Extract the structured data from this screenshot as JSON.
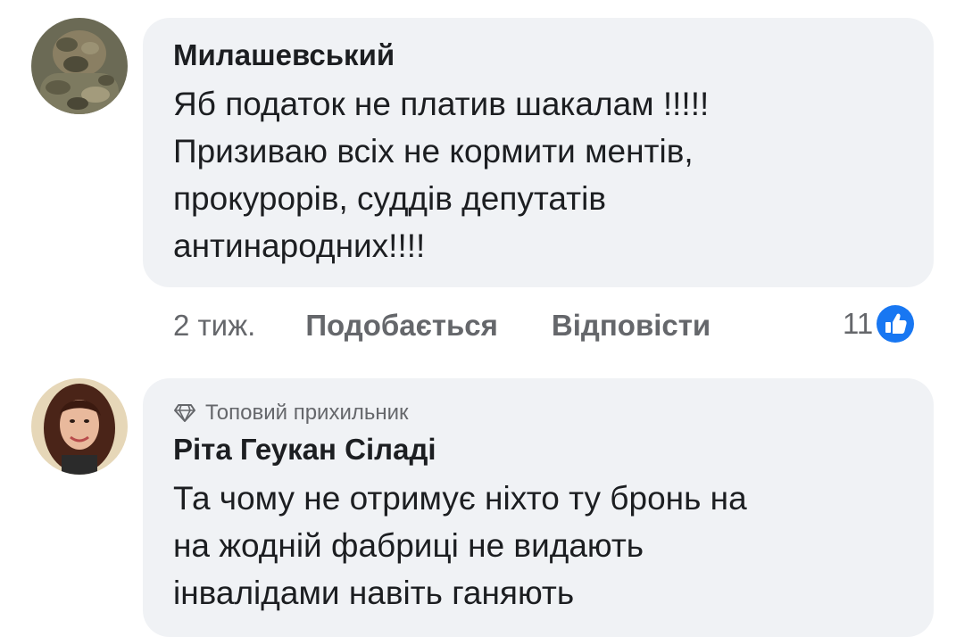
{
  "comments": [
    {
      "author": "Милашевський",
      "lines": [
        "Яб податок не платив шакалам !!!!!",
        "Призиваю всіх не кормити ментів,",
        "прокурорів, суддів депутатів",
        "антинародних!!!!"
      ],
      "time": "2 тиж.",
      "like_label": "Подобається",
      "reply_label": "Відповісти",
      "reaction_count": "11",
      "reaction_icon": "thumbs-up-icon",
      "avatar_icon": "camouflage-soldier-avatar"
    },
    {
      "badge": "Топовий прихильник",
      "badge_icon": "diamond-icon",
      "author": "Ріта Геукан Сіладі",
      "lines": [
        "Та чому не отримує ніхто ту бронь на",
        "на жодній фабриці не видають",
        "інвалідами навіть ганяють"
      ],
      "avatar_icon": "woman-portrait-avatar"
    }
  ],
  "colors": {
    "bubble": "#f0f2f5",
    "text": "#1c1e21",
    "secondary": "#65676b",
    "like_blue": "#1877f2"
  }
}
